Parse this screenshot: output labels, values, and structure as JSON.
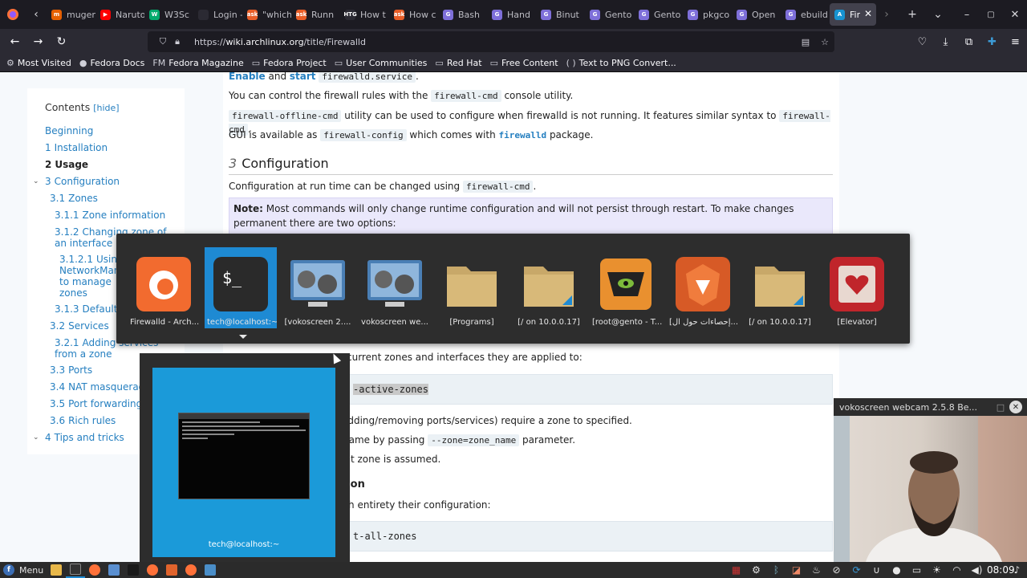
{
  "browser": {
    "tabs": [
      {
        "label": "mugen",
        "fav_color": "#e66000",
        "fav_glyph": "m"
      },
      {
        "label": "Naruto",
        "fav_color": "#ff0000",
        "fav_glyph": "▶"
      },
      {
        "label": "W3Sc",
        "fav_color": "#04aa6d",
        "fav_glyph": "W"
      },
      {
        "label": "Login - N",
        "fav_color": "#2b2a33",
        "fav_glyph": ""
      },
      {
        "label": "\"which",
        "fav_color": "#e85d27",
        "fav_glyph": "ask"
      },
      {
        "label": "Runn",
        "fav_color": "#e85d27",
        "fav_glyph": "ask"
      },
      {
        "label": "How t",
        "fav_color": "#2b2a33",
        "fav_glyph": "HTG"
      },
      {
        "label": "How c",
        "fav_color": "#e85d27",
        "fav_glyph": "ask"
      },
      {
        "label": "Bash",
        "fav_color": "#7e6fd9",
        "fav_glyph": "G"
      },
      {
        "label": "Hand",
        "fav_color": "#7e6fd9",
        "fav_glyph": "G"
      },
      {
        "label": "Binut",
        "fav_color": "#7e6fd9",
        "fav_glyph": "G"
      },
      {
        "label": "Gento",
        "fav_color": "#7e6fd9",
        "fav_glyph": "G"
      },
      {
        "label": "Gento",
        "fav_color": "#7e6fd9",
        "fav_glyph": "G"
      },
      {
        "label": "pkgco",
        "fav_color": "#7e6fd9",
        "fav_glyph": "G"
      },
      {
        "label": "Open",
        "fav_color": "#7e6fd9",
        "fav_glyph": "G"
      },
      {
        "label": "ebuild",
        "fav_color": "#7e6fd9",
        "fav_glyph": "G"
      },
      {
        "label": "Fir",
        "fav_color": "#1793d1",
        "fav_glyph": "A",
        "active": true
      }
    ],
    "url_scheme": "https://",
    "url_host": "wiki.archlinux.org",
    "url_path": "/title/Firewalld",
    "bookmarks": [
      {
        "icon": "⚙",
        "label": "Most Visited"
      },
      {
        "icon": "●",
        "label": "Fedora Docs"
      },
      {
        "icon": "FM",
        "label": "Fedora Magazine"
      },
      {
        "icon": "▭",
        "label": "Fedora Project"
      },
      {
        "icon": "▭",
        "label": "User Communities"
      },
      {
        "icon": "▭",
        "label": "Red Hat"
      },
      {
        "icon": "▭",
        "label": "Free Content"
      },
      {
        "icon": "( )",
        "label": "Text to PNG Convert..."
      }
    ]
  },
  "toc": {
    "title": "Contents",
    "hide": "[hide]",
    "items": [
      {
        "num": "",
        "label": "Beginning"
      },
      {
        "num": "1",
        "label": "Installation"
      },
      {
        "num": "2",
        "label": "Usage"
      },
      {
        "num": "3",
        "label": "Configuration"
      },
      {
        "num": "3.1",
        "label": "Zones"
      },
      {
        "num": "3.1.1",
        "label": "Zone information"
      },
      {
        "num": "3.1.2",
        "label": "Changing zone of an interface"
      },
      {
        "num": "3.1.2.1",
        "label": "Using NetworkManager to manage zones"
      },
      {
        "num": "3.1.3",
        "label": "Default zone"
      },
      {
        "num": "3.2",
        "label": "Services"
      },
      {
        "num": "3.2.1",
        "label": "Adding services from a zone"
      },
      {
        "num": "3.3",
        "label": "Ports"
      },
      {
        "num": "3.4",
        "label": "NAT masquerade"
      },
      {
        "num": "3.5",
        "label": "Port forwarding"
      },
      {
        "num": "3.6",
        "label": "Rich rules"
      },
      {
        "num": "4",
        "label": "Tips and tricks"
      }
    ]
  },
  "article": {
    "line1_a": "Enable",
    "line1_b": " and ",
    "line1_c": "start",
    "line1_code": "firewalld.service",
    "line1_end": ".",
    "line2_a": "You can control the firewall rules with the ",
    "line2_code": "firewall-cmd",
    "line2_b": " console utility.",
    "line3_code": "firewall-offline-cmd",
    "line3_a": " utility can be used to configure when firewalld is not running. It features similar syntax to ",
    "line3_code2": "firewall-cmd",
    "line3_end": ".",
    "line4_a": "GUI is available as ",
    "line4_code": "firewall-config",
    "line4_b": " which comes with ",
    "line4_link": "firewalld",
    "line4_c": " package.",
    "h2_num": "3",
    "h2_title": "Configuration",
    "line5_a": "Configuration at run time can be changed using ",
    "line5_code": "firewall-cmd",
    "line5_end": ".",
    "note_bold": "Note:",
    "note_text": " Most commands will only change runtime configuration and will not persist through restart. To make changes permanent there are two options:",
    "frag1": " current zones and interfaces they are applied to:",
    "code1": "-active-zones",
    "frag2": "adding/removing ports/services) require a zone to specified.",
    "frag3_a": "name by passing ",
    "frag3_code": "--zone=zone_name",
    "frag3_b": " parameter.",
    "frag4": "ult zone is assumed.",
    "frag5": "tion",
    "frag6": "ith entirety their configuration:",
    "code2": "t-all-zones"
  },
  "switcher": {
    "items": [
      {
        "label": "Firewalld - Arch..."
      },
      {
        "label": "tech@localhost:~",
        "active": true
      },
      {
        "label": "[vokoscreen 2...."
      },
      {
        "label": "vokoscreen we..."
      },
      {
        "label": "[Programs]"
      },
      {
        "label": "[/ on 10.0.0.17]"
      },
      {
        "label": "[root@gento - T..."
      },
      {
        "label": "[إحصاءات حول ال..."
      },
      {
        "label": "[/ on 10.0.0.17]"
      },
      {
        "label": "[Elevator]"
      }
    ],
    "terminal_glyph": "$_"
  },
  "preview": {
    "label": "tech@localhost:~"
  },
  "webcam": {
    "title": "vokoscreen webcam 2.5.8 Be...",
    "close": "✕",
    "minimize": "□"
  },
  "taskbar": {
    "menu_label": "Menu",
    "clock": "08:09"
  }
}
